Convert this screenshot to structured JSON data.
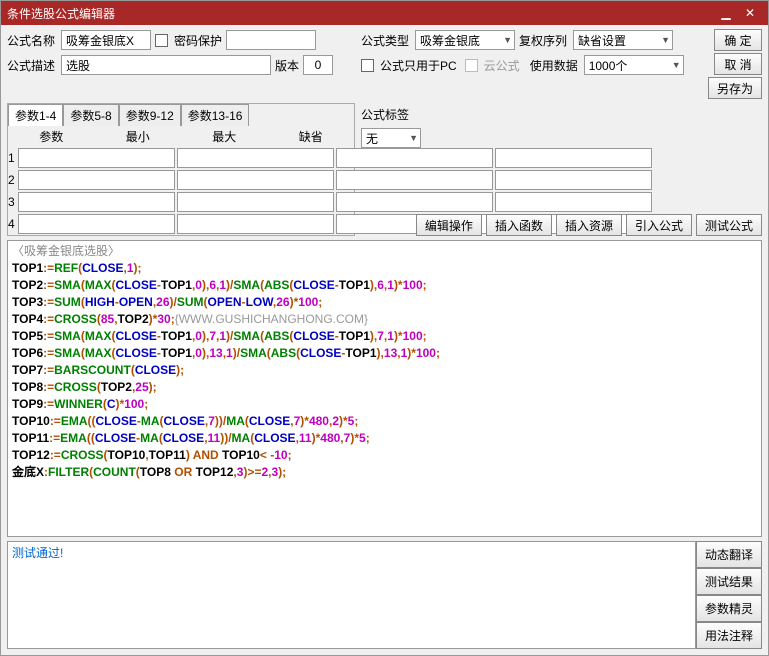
{
  "title": "条件选股公式编辑器",
  "labels": {
    "name": "公式名称",
    "pwd": "密码保护",
    "desc": "公式描述",
    "ver": "版本",
    "type": "公式类型",
    "rights": "复权序列",
    "pconly": "公式只用于PC",
    "cloud": "云公式",
    "usedata": "使用数据",
    "tag": "公式标签"
  },
  "values": {
    "name": "吸筹金银底X",
    "desc": "选股",
    "ver": "0",
    "type": "吸筹金银底",
    "reset": "缺省设置",
    "use": "1000个",
    "tag": "无"
  },
  "buttons": {
    "ok": "确 定",
    "cancel": "取 消",
    "saveas": "另存为",
    "editop": "编辑操作",
    "insfn": "插入函数",
    "insres": "插入资源",
    "import": "引入公式",
    "test": "测试公式",
    "dyntrans": "动态翻译",
    "testres": "测试结果",
    "paramhelp": "参数精灵",
    "usage": "用法注释"
  },
  "tabs": [
    "参数1-4",
    "参数5-8",
    "参数9-12",
    "参数13-16"
  ],
  "paramhead": [
    "参数",
    "最小",
    "最大",
    "缺省"
  ],
  "status": "测试通过!",
  "script_title": "〈吸筹金银底选股〉",
  "code": [
    {
      "v": "TOP1",
      "rhs": [
        {
          "t": "fn",
          "s": "REF"
        },
        {
          "t": "op",
          "s": "("
        },
        {
          "t": "id",
          "s": "CLOSE"
        },
        {
          "t": "op",
          "s": ","
        },
        {
          "t": "num",
          "s": "1"
        },
        {
          "t": "op",
          "s": ");"
        }
      ]
    },
    {
      "v": "TOP2",
      "rhs": [
        {
          "t": "fn",
          "s": "SMA"
        },
        {
          "t": "op",
          "s": "("
        },
        {
          "t": "fn",
          "s": "MAX"
        },
        {
          "t": "op",
          "s": "("
        },
        {
          "t": "id",
          "s": "CLOSE"
        },
        {
          "t": "op",
          "s": "-"
        },
        {
          "t": "bk",
          "s": "TOP1"
        },
        {
          "t": "op",
          "s": ","
        },
        {
          "t": "num",
          "s": "0"
        },
        {
          "t": "op",
          "s": "),"
        },
        {
          "t": "num",
          "s": "6"
        },
        {
          "t": "op",
          "s": ","
        },
        {
          "t": "num",
          "s": "1"
        },
        {
          "t": "op",
          "s": ")/"
        },
        {
          "t": "fn",
          "s": "SMA"
        },
        {
          "t": "op",
          "s": "("
        },
        {
          "t": "fn",
          "s": "ABS"
        },
        {
          "t": "op",
          "s": "("
        },
        {
          "t": "id",
          "s": "CLOSE"
        },
        {
          "t": "op",
          "s": "-"
        },
        {
          "t": "bk",
          "s": "TOP1"
        },
        {
          "t": "op",
          "s": "),"
        },
        {
          "t": "num",
          "s": "6"
        },
        {
          "t": "op",
          "s": ","
        },
        {
          "t": "num",
          "s": "1"
        },
        {
          "t": "op",
          "s": ")*"
        },
        {
          "t": "num",
          "s": "100"
        },
        {
          "t": "op",
          "s": ";"
        }
      ]
    },
    {
      "v": "TOP3",
      "rhs": [
        {
          "t": "fn",
          "s": "SUM"
        },
        {
          "t": "op",
          "s": "("
        },
        {
          "t": "id",
          "s": "HIGH"
        },
        {
          "t": "op",
          "s": "-"
        },
        {
          "t": "id",
          "s": "OPEN"
        },
        {
          "t": "op",
          "s": ","
        },
        {
          "t": "num",
          "s": "26"
        },
        {
          "t": "op",
          "s": ")/"
        },
        {
          "t": "fn",
          "s": "SUM"
        },
        {
          "t": "op",
          "s": "("
        },
        {
          "t": "id",
          "s": "OPEN"
        },
        {
          "t": "op",
          "s": "-"
        },
        {
          "t": "id",
          "s": "LOW"
        },
        {
          "t": "op",
          "s": ","
        },
        {
          "t": "num",
          "s": "26"
        },
        {
          "t": "op",
          "s": ")*"
        },
        {
          "t": "num",
          "s": "100"
        },
        {
          "t": "op",
          "s": ";"
        }
      ]
    },
    {
      "v": "TOP4",
      "rhs": [
        {
          "t": "fn",
          "s": "CROSS"
        },
        {
          "t": "op",
          "s": "("
        },
        {
          "t": "num",
          "s": "85"
        },
        {
          "t": "op",
          "s": ","
        },
        {
          "t": "bk",
          "s": "TOP2"
        },
        {
          "t": "op",
          "s": ")*"
        },
        {
          "t": "num",
          "s": "30"
        },
        {
          "t": "op",
          "s": ";"
        },
        {
          "t": "cm",
          "s": "{WWW.GUSHICHANGHONG.COM}"
        }
      ]
    },
    {
      "v": "TOP5",
      "rhs": [
        {
          "t": "fn",
          "s": "SMA"
        },
        {
          "t": "op",
          "s": "("
        },
        {
          "t": "fn",
          "s": "MAX"
        },
        {
          "t": "op",
          "s": "("
        },
        {
          "t": "id",
          "s": "CLOSE"
        },
        {
          "t": "op",
          "s": "-"
        },
        {
          "t": "bk",
          "s": "TOP1"
        },
        {
          "t": "op",
          "s": ","
        },
        {
          "t": "num",
          "s": "0"
        },
        {
          "t": "op",
          "s": "),"
        },
        {
          "t": "num",
          "s": "7"
        },
        {
          "t": "op",
          "s": ","
        },
        {
          "t": "num",
          "s": "1"
        },
        {
          "t": "op",
          "s": ")/"
        },
        {
          "t": "fn",
          "s": "SMA"
        },
        {
          "t": "op",
          "s": "("
        },
        {
          "t": "fn",
          "s": "ABS"
        },
        {
          "t": "op",
          "s": "("
        },
        {
          "t": "id",
          "s": "CLOSE"
        },
        {
          "t": "op",
          "s": "-"
        },
        {
          "t": "bk",
          "s": "TOP1"
        },
        {
          "t": "op",
          "s": "),"
        },
        {
          "t": "num",
          "s": "7"
        },
        {
          "t": "op",
          "s": ","
        },
        {
          "t": "num",
          "s": "1"
        },
        {
          "t": "op",
          "s": ")*"
        },
        {
          "t": "num",
          "s": "100"
        },
        {
          "t": "op",
          "s": ";"
        }
      ]
    },
    {
      "v": "TOP6",
      "rhs": [
        {
          "t": "fn",
          "s": "SMA"
        },
        {
          "t": "op",
          "s": "("
        },
        {
          "t": "fn",
          "s": "MAX"
        },
        {
          "t": "op",
          "s": "("
        },
        {
          "t": "id",
          "s": "CLOSE"
        },
        {
          "t": "op",
          "s": "-"
        },
        {
          "t": "bk",
          "s": "TOP1"
        },
        {
          "t": "op",
          "s": ","
        },
        {
          "t": "num",
          "s": "0"
        },
        {
          "t": "op",
          "s": "),"
        },
        {
          "t": "num",
          "s": "13"
        },
        {
          "t": "op",
          "s": ","
        },
        {
          "t": "num",
          "s": "1"
        },
        {
          "t": "op",
          "s": ")/"
        },
        {
          "t": "fn",
          "s": "SMA"
        },
        {
          "t": "op",
          "s": "("
        },
        {
          "t": "fn",
          "s": "ABS"
        },
        {
          "t": "op",
          "s": "("
        },
        {
          "t": "id",
          "s": "CLOSE"
        },
        {
          "t": "op",
          "s": "-"
        },
        {
          "t": "bk",
          "s": "TOP1"
        },
        {
          "t": "op",
          "s": "),"
        },
        {
          "t": "num",
          "s": "13"
        },
        {
          "t": "op",
          "s": ","
        },
        {
          "t": "num",
          "s": "1"
        },
        {
          "t": "op",
          "s": ")*"
        },
        {
          "t": "num",
          "s": "100"
        },
        {
          "t": "op",
          "s": ";"
        }
      ]
    },
    {
      "v": "TOP7",
      "rhs": [
        {
          "t": "fn",
          "s": "BARSCOUNT"
        },
        {
          "t": "op",
          "s": "("
        },
        {
          "t": "id",
          "s": "CLOSE"
        },
        {
          "t": "op",
          "s": ");"
        }
      ]
    },
    {
      "v": "TOP8",
      "rhs": [
        {
          "t": "fn",
          "s": "CROSS"
        },
        {
          "t": "op",
          "s": "("
        },
        {
          "t": "bk",
          "s": "TOP2"
        },
        {
          "t": "op",
          "s": ","
        },
        {
          "t": "num",
          "s": "25"
        },
        {
          "t": "op",
          "s": ");"
        }
      ]
    },
    {
      "v": "TOP9",
      "rhs": [
        {
          "t": "fn",
          "s": "WINNER"
        },
        {
          "t": "op",
          "s": "("
        },
        {
          "t": "id",
          "s": "C"
        },
        {
          "t": "op",
          "s": ")*"
        },
        {
          "t": "num",
          "s": "100"
        },
        {
          "t": "op",
          "s": ";"
        }
      ]
    },
    {
      "v": "TOP10",
      "rhs": [
        {
          "t": "fn",
          "s": "EMA"
        },
        {
          "t": "op",
          "s": "(("
        },
        {
          "t": "id",
          "s": "CLOSE"
        },
        {
          "t": "op",
          "s": "-"
        },
        {
          "t": "fn",
          "s": "MA"
        },
        {
          "t": "op",
          "s": "("
        },
        {
          "t": "id",
          "s": "CLOSE"
        },
        {
          "t": "op",
          "s": ","
        },
        {
          "t": "num",
          "s": "7"
        },
        {
          "t": "op",
          "s": "))/"
        },
        {
          "t": "fn",
          "s": "MA"
        },
        {
          "t": "op",
          "s": "("
        },
        {
          "t": "id",
          "s": "CLOSE"
        },
        {
          "t": "op",
          "s": ","
        },
        {
          "t": "num",
          "s": "7"
        },
        {
          "t": "op",
          "s": ")*"
        },
        {
          "t": "num",
          "s": "480"
        },
        {
          "t": "op",
          "s": ","
        },
        {
          "t": "num",
          "s": "2"
        },
        {
          "t": "op",
          "s": ")*"
        },
        {
          "t": "num",
          "s": "5"
        },
        {
          "t": "op",
          "s": ";"
        }
      ]
    },
    {
      "v": "TOP11",
      "rhs": [
        {
          "t": "fn",
          "s": "EMA"
        },
        {
          "t": "op",
          "s": "(("
        },
        {
          "t": "id",
          "s": "CLOSE"
        },
        {
          "t": "op",
          "s": "-"
        },
        {
          "t": "fn",
          "s": "MA"
        },
        {
          "t": "op",
          "s": "("
        },
        {
          "t": "id",
          "s": "CLOSE"
        },
        {
          "t": "op",
          "s": ","
        },
        {
          "t": "num",
          "s": "11"
        },
        {
          "t": "op",
          "s": "))/"
        },
        {
          "t": "fn",
          "s": "MA"
        },
        {
          "t": "op",
          "s": "("
        },
        {
          "t": "id",
          "s": "CLOSE"
        },
        {
          "t": "op",
          "s": ","
        },
        {
          "t": "num",
          "s": "11"
        },
        {
          "t": "op",
          "s": ")*"
        },
        {
          "t": "num",
          "s": "480"
        },
        {
          "t": "op",
          "s": ","
        },
        {
          "t": "num",
          "s": "7"
        },
        {
          "t": "op",
          "s": ")*"
        },
        {
          "t": "num",
          "s": "5"
        },
        {
          "t": "op",
          "s": ";"
        }
      ]
    },
    {
      "v": "TOP12",
      "rhs": [
        {
          "t": "fn",
          "s": "CROSS"
        },
        {
          "t": "op",
          "s": "("
        },
        {
          "t": "bk",
          "s": "TOP10"
        },
        {
          "t": "op",
          "s": ","
        },
        {
          "t": "bk",
          "s": "TOP11"
        },
        {
          "t": "op",
          "s": ") "
        },
        {
          "t": "kw",
          "s": "AND"
        },
        {
          "t": "op",
          "s": " "
        },
        {
          "t": "bk",
          "s": "TOP10"
        },
        {
          "t": "op",
          "s": "< -"
        },
        {
          "t": "num",
          "s": "10"
        },
        {
          "t": "op",
          "s": ";"
        }
      ]
    },
    {
      "v": "金底X",
      "out": true,
      "rhs": [
        {
          "t": "fn",
          "s": "FILTER"
        },
        {
          "t": "op",
          "s": "("
        },
        {
          "t": "fn",
          "s": "COUNT"
        },
        {
          "t": "op",
          "s": "("
        },
        {
          "t": "bk",
          "s": "TOP8"
        },
        {
          "t": "op",
          "s": " "
        },
        {
          "t": "kw",
          "s": "OR"
        },
        {
          "t": "op",
          "s": " "
        },
        {
          "t": "bk",
          "s": "TOP12"
        },
        {
          "t": "op",
          "s": ","
        },
        {
          "t": "num",
          "s": "3"
        },
        {
          "t": "op",
          "s": ")>="
        },
        {
          "t": "num",
          "s": "2"
        },
        {
          "t": "op",
          "s": ","
        },
        {
          "t": "num",
          "s": "3"
        },
        {
          "t": "op",
          "s": ");"
        }
      ]
    }
  ]
}
